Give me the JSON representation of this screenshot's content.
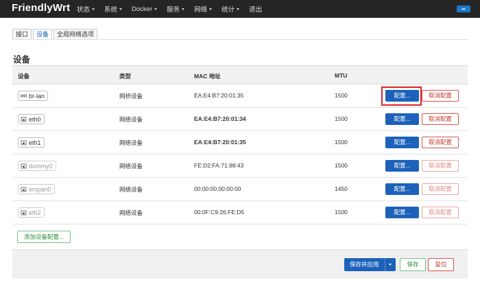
{
  "brand": "FriendlyWrt",
  "menu": [
    {
      "label": "状态",
      "caret": true
    },
    {
      "label": "系统",
      "caret": true
    },
    {
      "label": "Docker",
      "caret": true
    },
    {
      "label": "服务",
      "caret": true
    },
    {
      "label": "网络",
      "caret": true
    },
    {
      "label": "统计",
      "caret": true
    },
    {
      "label": "退出",
      "caret": false
    }
  ],
  "tabs": [
    "接口",
    "设备",
    "全局网络选项"
  ],
  "active_tab": "设备",
  "section_title": "设备",
  "table": {
    "headers": [
      "设备",
      "类型",
      "MAC 地址",
      "MTU"
    ],
    "rows": [
      {
        "device": "br-lan",
        "icon": "bridge-icon",
        "type": "网桥设备",
        "mac": "EA:E4:B7:20:01:35",
        "mac_bold": false,
        "mtu": "1500",
        "dim": false
      },
      {
        "device": "eth0",
        "icon": "ethernet-icon",
        "type": "网络设备",
        "mac": "EA:E4:B7:20:01:34",
        "mac_bold": true,
        "mtu": "1500",
        "dim": false
      },
      {
        "device": "eth1",
        "icon": "ethernet-icon",
        "type": "网络设备",
        "mac": "EA:E4:B7:20:01:35",
        "mac_bold": true,
        "mtu": "1500",
        "dim": false
      },
      {
        "device": "dummy0",
        "icon": "ethernet-icon",
        "type": "网络设备",
        "mac": "FE:D2:FA:71:98:43",
        "mac_bold": false,
        "mtu": "1500",
        "dim": true
      },
      {
        "device": "erspan0",
        "icon": "ethernet-icon",
        "type": "网络设备",
        "mac": "00:00:00:00:00:00",
        "mac_bold": false,
        "mtu": "1450",
        "dim": true
      },
      {
        "device": "eth2",
        "icon": "ethernet-icon",
        "type": "网络设备",
        "mac": "00:0F:C9:26:FE:D5",
        "mac_bold": false,
        "mtu": "1500",
        "dim": true
      }
    ],
    "config_label": "配置...",
    "remove_label": "取消配置"
  },
  "add_button": "添加设备配置...",
  "footer": {
    "save_apply": "保存并应用",
    "save": "保存",
    "reset": "复位"
  },
  "colors": {
    "navbar": "#252525",
    "primary": "#1d62ba",
    "danger": "#d9534f",
    "success": "#2e8b3c",
    "highlight": "#dd2222"
  }
}
